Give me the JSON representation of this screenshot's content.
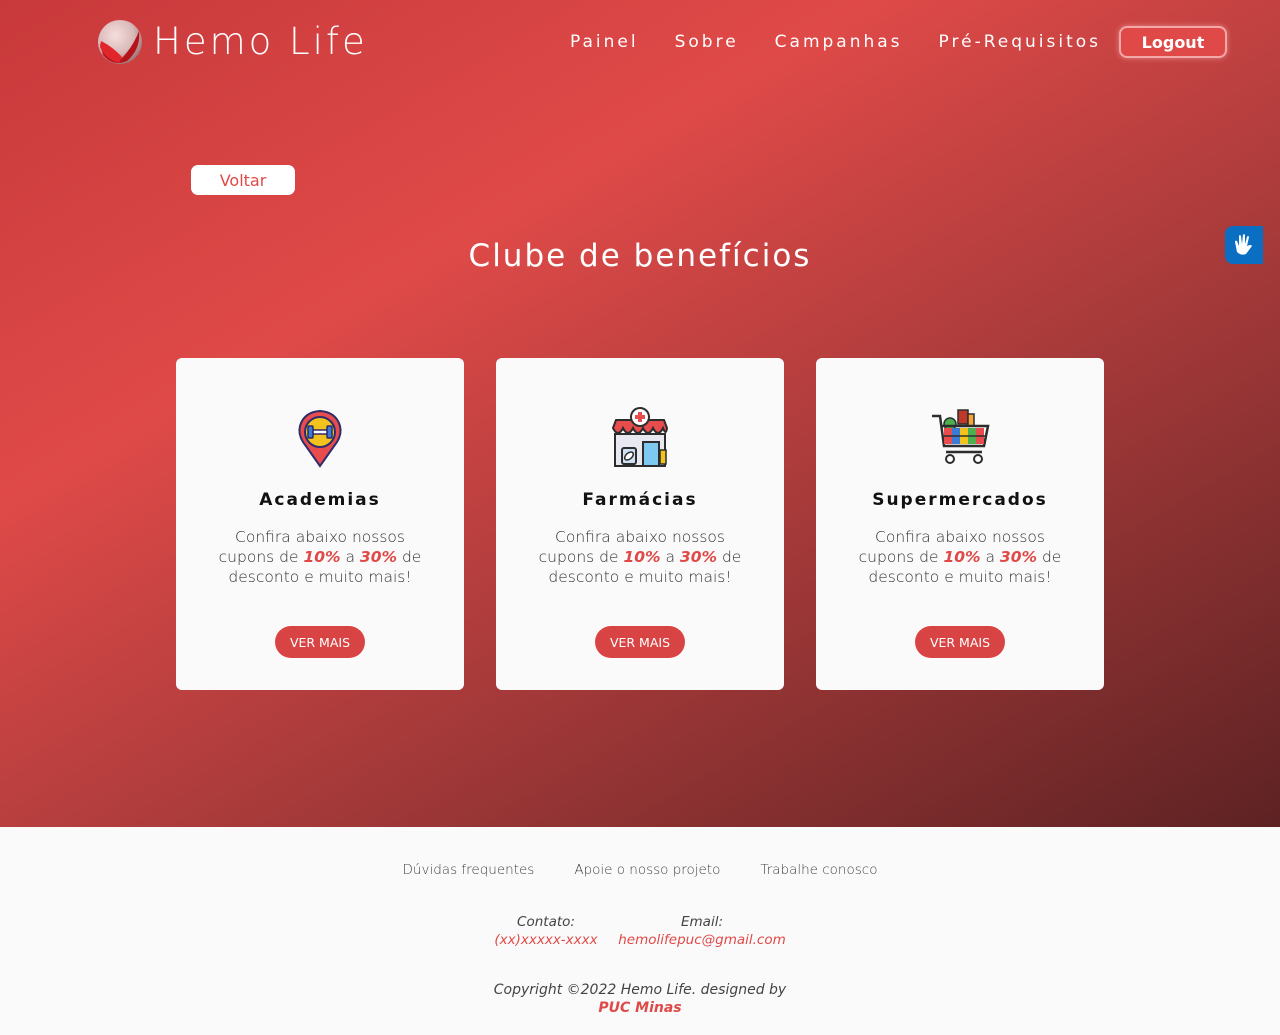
{
  "header": {
    "logo_text": "Hemo Life",
    "nav": [
      "Painel",
      "Sobre",
      "Campanhas",
      "Pré-Requisitos"
    ],
    "logout_label": "Logout"
  },
  "back_label": "Voltar",
  "page_title": "Clube de benefícios",
  "cards": [
    {
      "title": "Academias",
      "text_before": "Confira abaixo nossos cupons de ",
      "discount_min": "10%",
      "text_mid": " a ",
      "discount_max": "30%",
      "text_after": " de desconto e muito mais!",
      "button": "VER MAIS",
      "icon": "gym-location-icon"
    },
    {
      "title": "Farmácias",
      "text_before": "Confira abaixo nossos cupons de ",
      "discount_min": "10%",
      "text_mid": " a ",
      "discount_max": "30%",
      "text_after": " de desconto e muito mais!",
      "button": "VER MAIS",
      "icon": "pharmacy-icon"
    },
    {
      "title": "Supermercados",
      "text_before": "Confira abaixo nossos cupons de ",
      "discount_min": "10%",
      "text_mid": " a ",
      "discount_max": "30%",
      "text_after": " de desconto e muito mais!",
      "button": "VER MAIS",
      "icon": "shopping-cart-icon"
    }
  ],
  "footer": {
    "links": [
      "Dúvidas frequentes",
      "Apoie o nosso projeto",
      "Trabalhe conosco"
    ],
    "contact_label": "Contato:",
    "contact_value": "(xx)xxxxx-xxxx",
    "email_label": "Email:",
    "email_value": "hemolifepuc@gmail.com",
    "copyright": "Copyright ©2022 Hemo Life. designed by",
    "organization": "PUC Minas"
  },
  "colors": {
    "accent": "#df4a48",
    "a11y": "#0a6fc2"
  }
}
